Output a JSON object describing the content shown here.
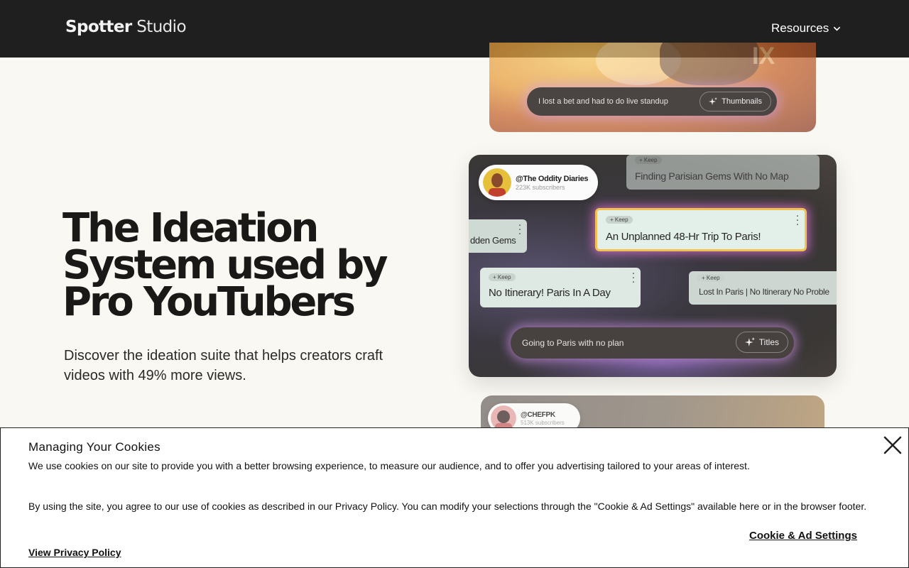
{
  "nav": {
    "logo_bold": "Spotter",
    "logo_light": "Studio",
    "resources_label": "Resources"
  },
  "hero": {
    "title_lines": [
      "The Ideation",
      "System used by",
      "Pro YouTubers"
    ],
    "subtitle": "Discover the ideation suite that helps creators craft videos with 49% more views."
  },
  "cards": {
    "top": {
      "prompt": "I lost a bet and had to do live standup",
      "button": "Thumbnails",
      "art_text": "IX"
    },
    "middle": {
      "creator_name": "@The Oddity Diaries",
      "creator_subs": "223K subscribers",
      "prompt": "Going to Paris with no plan",
      "button": "Titles",
      "ideas": [
        {
          "keep": "+ Keep",
          "text": "Finding Parisian Gems With No Map"
        },
        {
          "keep": "+ Keep",
          "text": "An Unplanned 48-Hr Trip To Paris!"
        },
        {
          "keep": "",
          "text": "dden Gems"
        },
        {
          "keep": "+ Keep",
          "text": "No Itinerary! Paris In A Day"
        },
        {
          "keep": "+ Keep",
          "text": "Lost In Paris | No Itinerary No Proble"
        }
      ]
    },
    "bottom": {
      "creator_name": "@CHEFPK",
      "creator_subs": "513K subscribers"
    }
  },
  "cookie": {
    "title": "Managing Your Cookies",
    "paragraph1": "We use cookies on our site to provide you with a better browsing experience, to measure our audience, and to offer you advertising tailored to your areas of interest.",
    "paragraph2": "By using the site, you agree to our use of cookies as described in our Privacy Policy. You can modify your selections through the \"Cookie & Ad Settings\" available here or in the browser footer.",
    "settings_label": "Cookie & Ad Settings",
    "privacy_label": "View Privacy Policy"
  },
  "icons": {
    "chevron": "chevron-down-icon",
    "sparkle": "sparkle-icon",
    "close": "close-icon",
    "more": "more-vertical-icon"
  }
}
